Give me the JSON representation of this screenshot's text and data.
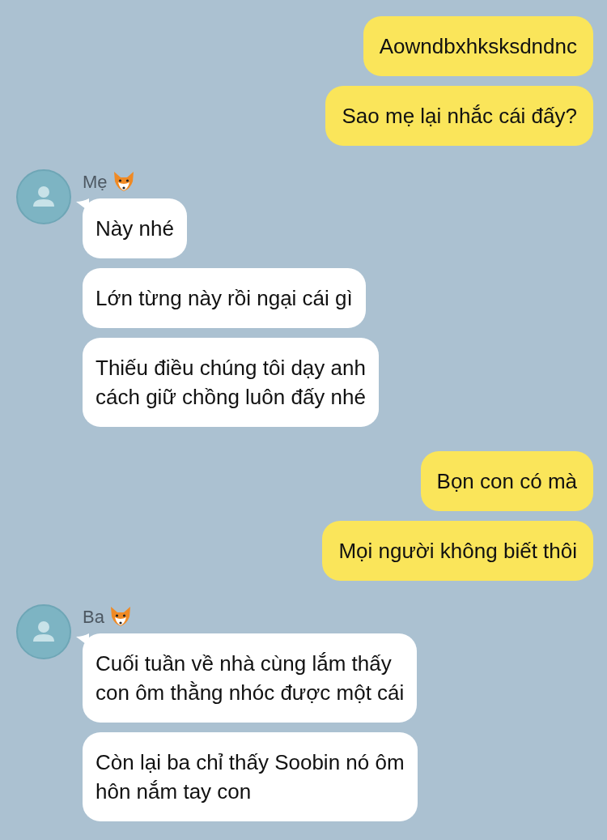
{
  "messages": [
    {
      "kind": "outgoing",
      "texts": [
        "Aowndbxhksksdndnc",
        "Sao mẹ lại nhắc cái đấy?"
      ]
    },
    {
      "kind": "incoming",
      "sender": "Mẹ",
      "texts": [
        "Này nhé",
        "Lớn từng này rồi ngại cái gì",
        "Thiếu điều chúng tôi dạy anh\ncách giữ chồng luôn đấy nhé"
      ]
    },
    {
      "kind": "outgoing",
      "texts": [
        "Bọn con có mà",
        "Mọi người không biết thôi"
      ]
    },
    {
      "kind": "incoming",
      "sender": "Ba",
      "texts": [
        "Cuối tuần về nhà cùng lắm thấy\ncon ôm thằng nhóc được một cái",
        "Còn lại ba chỉ thấy Soobin nó ôm\nhôn nắm tay con"
      ]
    }
  ]
}
